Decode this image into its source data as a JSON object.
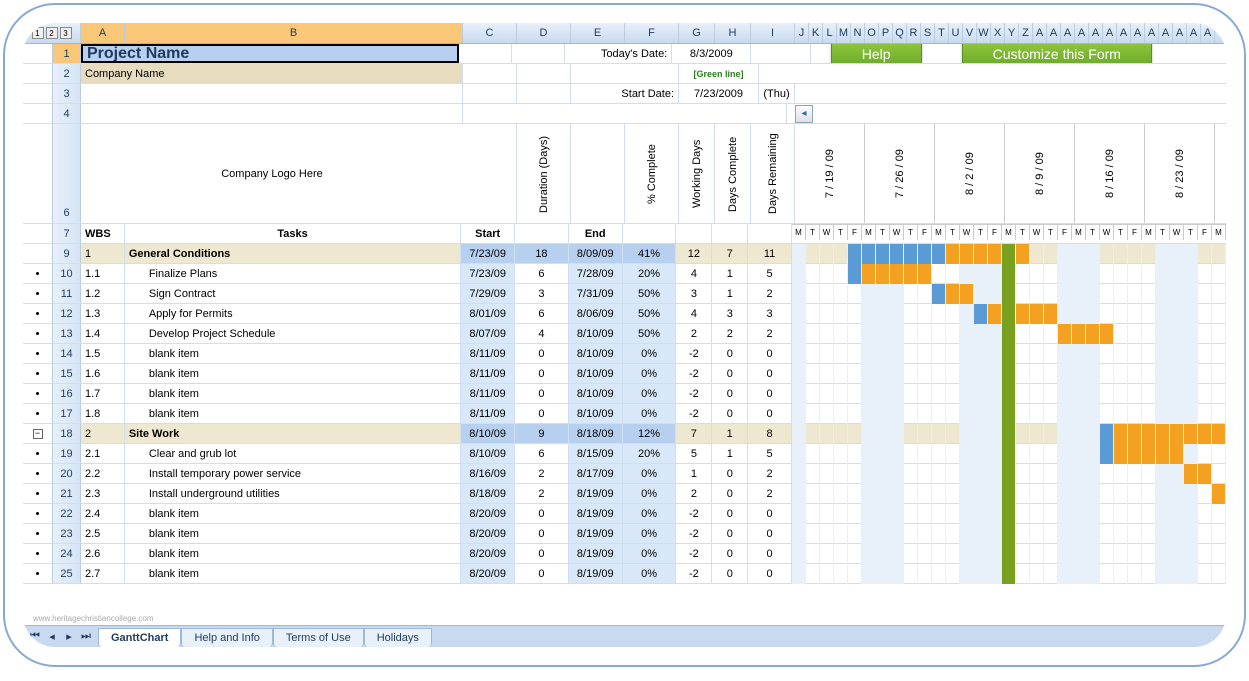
{
  "columns": {
    "a": "A",
    "b": "B",
    "cg": [
      "C",
      "D",
      "E",
      "F",
      "G",
      "H",
      "I"
    ],
    "extra": [
      "J",
      "K",
      "L",
      "M",
      "N",
      "O",
      "P",
      "Q",
      "R",
      "S",
      "T",
      "U",
      "V",
      "W",
      "X",
      "Y",
      "Z",
      "A",
      "A",
      "A",
      "A",
      "A",
      "A",
      "A",
      "A",
      "A",
      "A",
      "A",
      "A",
      "A"
    ]
  },
  "outline_levels": [
    "1",
    "2",
    "3"
  ],
  "row1": {
    "title": "Project Name",
    "today_lbl": "Today's Date:",
    "today_val": "8/3/2009",
    "green_line": "[Green line]"
  },
  "row2": {
    "company": "Company Name"
  },
  "row3": {
    "start_lbl": "Start Date:",
    "start_val": "7/23/2009",
    "day": "(Thu)"
  },
  "buttons": {
    "help": "Help",
    "customize": "Customize this Form"
  },
  "logo_text": "Company Logo Here",
  "headers": {
    "wbs": "WBS",
    "tasks": "Tasks",
    "start": "Start",
    "duration": "Duration (Days)",
    "end": "End",
    "pct": "% Complete",
    "working": "Working Days",
    "daysc": "Days Complete",
    "daysr": "Days Remaining"
  },
  "week_dates": [
    "7 / 19 / 09",
    "7 / 26 / 09",
    "8 / 2 / 09",
    "8 / 9 / 09",
    "8 / 16 / 09",
    "8 / 23 / 09"
  ],
  "day_labels": [
    "M",
    "T",
    "W",
    "T",
    "F",
    "M",
    "T",
    "W",
    "T",
    "F",
    "M",
    "T",
    "W",
    "T",
    "F",
    "M",
    "T",
    "W",
    "T",
    "F",
    "M",
    "T",
    "W",
    "T",
    "F",
    "M",
    "T",
    "W",
    "T",
    "F",
    "M"
  ],
  "tasks": [
    {
      "rn": "9",
      "wbs": "1",
      "name": "General Conditions",
      "start": "7/23/09",
      "dur": "18",
      "end": "8/09/09",
      "pct": "41%",
      "wd": "12",
      "dc": "7",
      "dr": "11",
      "section": true,
      "bars": [
        {
          "s": 4,
          "e": 11,
          "c": "b"
        },
        {
          "s": 11,
          "e": 17,
          "c": "o"
        }
      ]
    },
    {
      "rn": "10",
      "wbs": "1.1",
      "name": "Finalize Plans",
      "start": "7/23/09",
      "dur": "6",
      "end": "7/28/09",
      "pct": "20%",
      "wd": "4",
      "dc": "1",
      "dr": "5",
      "bars": [
        {
          "s": 4,
          "e": 5,
          "c": "b"
        },
        {
          "s": 5,
          "e": 10,
          "c": "o"
        }
      ]
    },
    {
      "rn": "11",
      "wbs": "1.2",
      "name": "Sign Contract",
      "start": "7/29/09",
      "dur": "3",
      "end": "7/31/09",
      "pct": "50%",
      "wd": "3",
      "dc": "1",
      "dr": "2",
      "bars": [
        {
          "s": 10,
          "e": 11,
          "c": "b"
        },
        {
          "s": 11,
          "e": 13,
          "c": "o"
        }
      ]
    },
    {
      "rn": "12",
      "wbs": "1.3",
      "name": "Apply for Permits",
      "start": "8/01/09",
      "dur": "6",
      "end": "8/06/09",
      "pct": "50%",
      "wd": "4",
      "dc": "3",
      "dr": "3",
      "bars": [
        {
          "s": 13,
          "e": 14,
          "c": "b"
        },
        {
          "s": 14,
          "e": 19,
          "c": "o"
        }
      ]
    },
    {
      "rn": "13",
      "wbs": "1.4",
      "name": "Develop Project Schedule",
      "start": "8/07/09",
      "dur": "4",
      "end": "8/10/09",
      "pct": "50%",
      "wd": "2",
      "dc": "2",
      "dr": "2",
      "bars": [
        {
          "s": 19,
          "e": 23,
          "c": "o"
        }
      ]
    },
    {
      "rn": "14",
      "wbs": "1.5",
      "name": "blank item",
      "start": "8/11/09",
      "dur": "0",
      "end": "8/10/09",
      "pct": "0%",
      "wd": "-2",
      "dc": "0",
      "dr": "0",
      "bars": []
    },
    {
      "rn": "15",
      "wbs": "1.6",
      "name": "blank item",
      "start": "8/11/09",
      "dur": "0",
      "end": "8/10/09",
      "pct": "0%",
      "wd": "-2",
      "dc": "0",
      "dr": "0",
      "bars": []
    },
    {
      "rn": "16",
      "wbs": "1.7",
      "name": "blank item",
      "start": "8/11/09",
      "dur": "0",
      "end": "8/10/09",
      "pct": "0%",
      "wd": "-2",
      "dc": "0",
      "dr": "0",
      "bars": []
    },
    {
      "rn": "17",
      "wbs": "1.8",
      "name": "blank item",
      "start": "8/11/09",
      "dur": "0",
      "end": "8/10/09",
      "pct": "0%",
      "wd": "-2",
      "dc": "0",
      "dr": "0",
      "bars": []
    },
    {
      "rn": "18",
      "wbs": "2",
      "name": "Site Work",
      "start": "8/10/09",
      "dur": "9",
      "end": "8/18/09",
      "pct": "12%",
      "wd": "7",
      "dc": "1",
      "dr": "8",
      "section": true,
      "outline": "minus",
      "bars": [
        {
          "s": 22,
          "e": 23,
          "c": "b"
        },
        {
          "s": 23,
          "e": 31,
          "c": "o"
        }
      ]
    },
    {
      "rn": "19",
      "wbs": "2.1",
      "name": "Clear and grub lot",
      "start": "8/10/09",
      "dur": "6",
      "end": "8/15/09",
      "pct": "20%",
      "wd": "5",
      "dc": "1",
      "dr": "5",
      "bars": [
        {
          "s": 22,
          "e": 23,
          "c": "b"
        },
        {
          "s": 23,
          "e": 28,
          "c": "o"
        }
      ]
    },
    {
      "rn": "20",
      "wbs": "2.2",
      "name": "Install temporary power service",
      "start": "8/16/09",
      "dur": "2",
      "end": "8/17/09",
      "pct": "0%",
      "wd": "1",
      "dc": "0",
      "dr": "2",
      "bars": [
        {
          "s": 28,
          "e": 30,
          "c": "o"
        }
      ]
    },
    {
      "rn": "21",
      "wbs": "2.3",
      "name": "Install underground utilities",
      "start": "8/18/09",
      "dur": "2",
      "end": "8/19/09",
      "pct": "0%",
      "wd": "2",
      "dc": "0",
      "dr": "2",
      "bars": [
        {
          "s": 30,
          "e": 32,
          "c": "o"
        }
      ]
    },
    {
      "rn": "22",
      "wbs": "2.4",
      "name": "blank item",
      "start": "8/20/09",
      "dur": "0",
      "end": "8/19/09",
      "pct": "0%",
      "wd": "-2",
      "dc": "0",
      "dr": "0",
      "bars": []
    },
    {
      "rn": "23",
      "wbs": "2.5",
      "name": "blank item",
      "start": "8/20/09",
      "dur": "0",
      "end": "8/19/09",
      "pct": "0%",
      "wd": "-2",
      "dc": "0",
      "dr": "0",
      "bars": []
    },
    {
      "rn": "24",
      "wbs": "2.6",
      "name": "blank item",
      "start": "8/20/09",
      "dur": "0",
      "end": "8/19/09",
      "pct": "0%",
      "wd": "-2",
      "dc": "0",
      "dr": "0",
      "bars": []
    },
    {
      "rn": "25",
      "wbs": "2.7",
      "name": "blank item",
      "start": "8/20/09",
      "dur": "0",
      "end": "8/19/09",
      "pct": "0%",
      "wd": "-2",
      "dc": "0",
      "dr": "0",
      "bars": []
    }
  ],
  "today_col": 15,
  "tabs": {
    "active": "GanttChart",
    "others": [
      "Help and Info",
      "Terms of Use",
      "Holidays"
    ]
  },
  "watermark": "www.heritagechristiancollege.com"
}
